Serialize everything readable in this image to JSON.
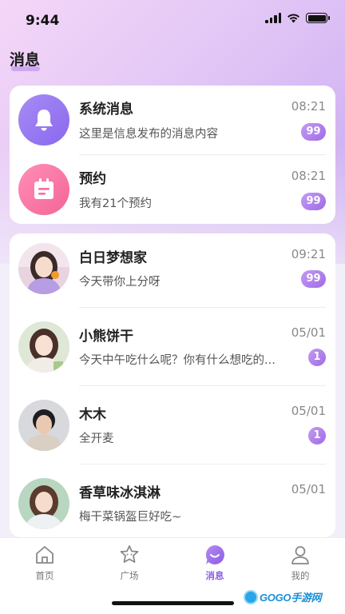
{
  "status_bar": {
    "time": "9:44"
  },
  "header": {
    "title": "消息"
  },
  "system_messages": [
    {
      "name": "系统消息",
      "preview": "这里是信息发布的消息内容",
      "time": "08:21",
      "badge": "99",
      "icon": "bell-icon"
    },
    {
      "name": "预约",
      "preview": "我有21个预约",
      "time": "08:21",
      "badge": "99",
      "icon": "calendar-icon"
    }
  ],
  "chats": [
    {
      "name": "白日梦想家",
      "preview": "今天带你上分呀",
      "time": "09:21",
      "badge": "99"
    },
    {
      "name": "小熊饼干",
      "preview": "今天中午吃什么呢？你有什么想吃的...",
      "time": "05/01",
      "badge": "1"
    },
    {
      "name": "木木",
      "preview": "全开麦",
      "time": "05/01",
      "badge": "1"
    },
    {
      "name": "香草味冰淇淋",
      "preview": "梅干菜锅盔巨好吃~",
      "time": "05/01",
      "badge": ""
    }
  ],
  "tab_bar": {
    "tabs": [
      {
        "label": "首页",
        "icon": "home-icon",
        "active": false
      },
      {
        "label": "广场",
        "icon": "star-face-icon",
        "active": false
      },
      {
        "label": "消息",
        "icon": "message-icon",
        "active": true
      },
      {
        "label": "我的",
        "icon": "profile-icon",
        "active": false
      }
    ]
  },
  "watermark": {
    "text": "GOGO手游网"
  },
  "colors": {
    "accent": "#8b5fe6",
    "badge": "#a878ec",
    "bell": "#977af2",
    "calendar": "#f877a6"
  }
}
